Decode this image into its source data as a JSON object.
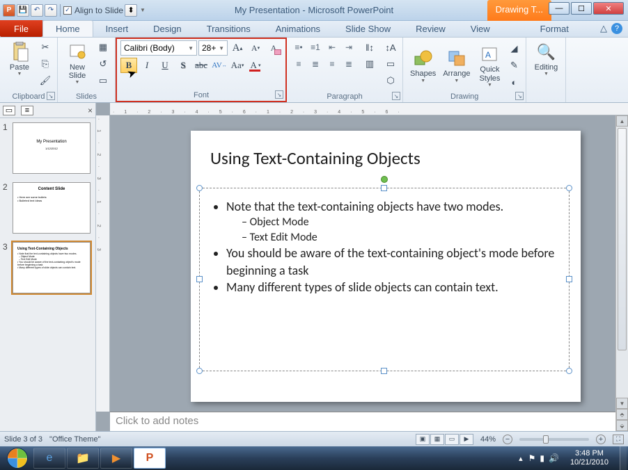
{
  "titlebar": {
    "align_label": "Align to Slide",
    "app_title": "My Presentation  -  Microsoft PowerPoint",
    "context_tab": "Drawing T..."
  },
  "tabs": {
    "file": "File",
    "home": "Home",
    "insert": "Insert",
    "design": "Design",
    "transitions": "Transitions",
    "animations": "Animations",
    "slideshow": "Slide Show",
    "review": "Review",
    "view": "View",
    "format": "Format"
  },
  "ribbon": {
    "clipboard": {
      "label": "Clipboard",
      "paste": "Paste"
    },
    "slides": {
      "label": "Slides",
      "new_slide": "New\nSlide"
    },
    "font": {
      "label": "Font",
      "name": "Calibri (Body)",
      "size": "28+"
    },
    "paragraph": {
      "label": "Paragraph"
    },
    "drawing": {
      "label": "Drawing",
      "shapes": "Shapes",
      "arrange": "Arrange",
      "quick_styles": "Quick\nStyles"
    },
    "editing": {
      "label": "Editing"
    }
  },
  "thumbs": {
    "s1": {
      "title": "My Presentation",
      "sub": "1/12/2012"
    },
    "s2": {
      "title": "Content Slide",
      "b1": "Here are some bullets",
      "b2": "Bulleted text ideas"
    },
    "s3": {
      "title": "Using Text-Containing Objects"
    }
  },
  "slide": {
    "title": "Using Text-Containing Objects",
    "b1": "Note that the text-containing objects have two modes.",
    "b1a": "Object Mode",
    "b1b": "Text Edit Mode",
    "b2": "You should be aware of the text-containing object's mode before beginning a task",
    "b3": "Many different types of slide objects can contain text."
  },
  "notes_placeholder": "Click to add notes",
  "status": {
    "slide": "Slide 3 of 3",
    "theme": "\"Office Theme\"",
    "zoom": "44%"
  },
  "tray": {
    "time": "3:48 PM",
    "date": "10/21/2010"
  }
}
